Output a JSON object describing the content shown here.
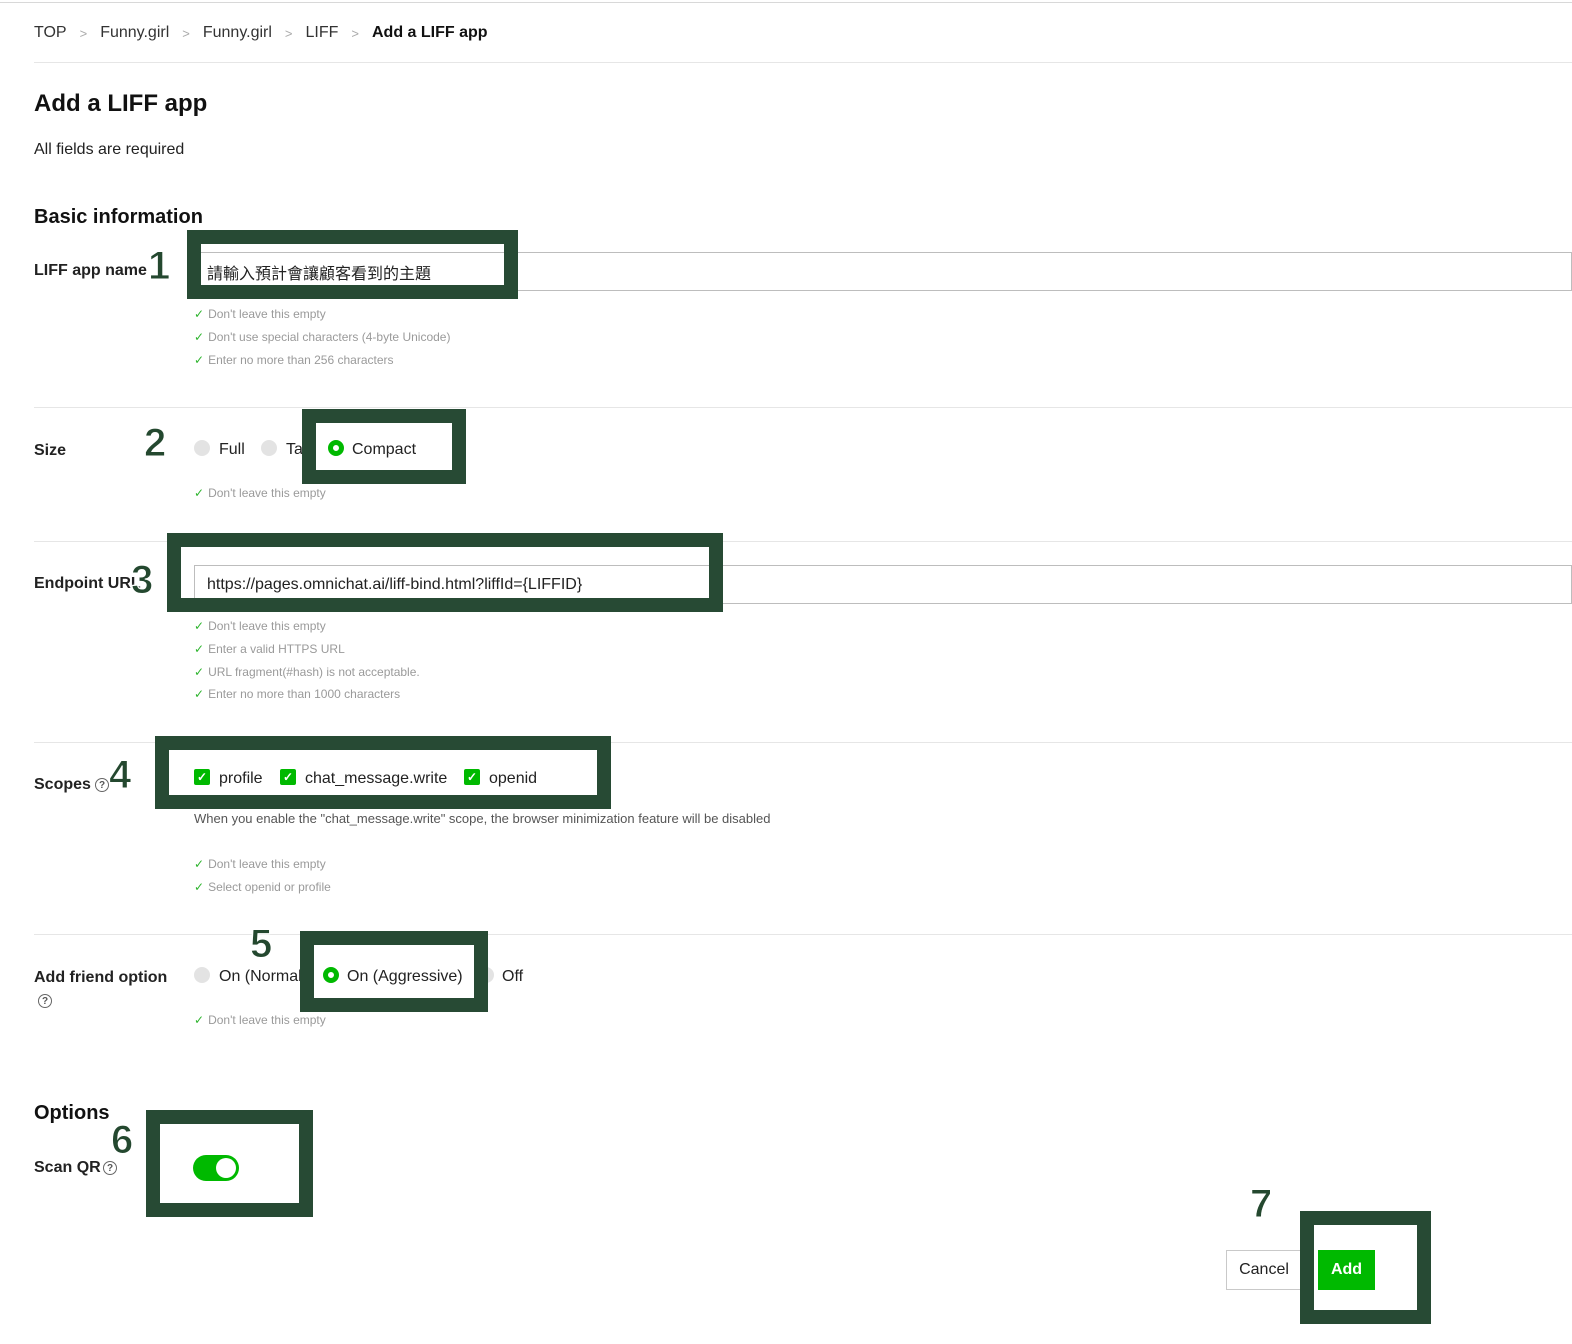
{
  "breadcrumb": [
    "TOP",
    "Funny.girl",
    "Funny.girl",
    "LIFF",
    "Add a LIFF app"
  ],
  "page_title": "Add a LIFF app",
  "required_note": "All fields are required",
  "basic_section_title": "Basic information",
  "app_name": {
    "label": "LIFF app name",
    "value": "請輸入預計會讓顧客看到的主題",
    "hints": [
      "Don't leave this empty",
      "Don't use special characters (4-byte Unicode)",
      "Enter no more than 256 characters"
    ]
  },
  "size": {
    "label": "Size",
    "options": [
      "Full",
      "Ta",
      "Compact"
    ],
    "selected": "Compact",
    "hints": [
      "Don't leave this empty"
    ]
  },
  "endpoint": {
    "label": "Endpoint URL",
    "value": "https://pages.omnichat.ai/liff-bind.html?liffId={LIFFID}",
    "hints": [
      "Don't leave this empty",
      "Enter a valid HTTPS URL",
      "URL fragment(#hash) is not acceptable.",
      "Enter no more than 1000 characters"
    ]
  },
  "scopes": {
    "label": "Scopes",
    "options": [
      "profile",
      "chat_message.write",
      "openid"
    ],
    "checked": [
      "profile",
      "chat_message.write",
      "openid"
    ],
    "note": "When you enable the \"chat_message.write\" scope, the browser minimization feature will be disabled",
    "hints": [
      "Don't leave this empty",
      "Select openid or profile"
    ]
  },
  "add_friend": {
    "label": "Add friend option",
    "options": [
      "On (Normal",
      "On (Aggressive)",
      "Off"
    ],
    "selected": "On (Aggressive)",
    "hints": [
      "Don't leave this empty"
    ]
  },
  "options_section_title": "Options",
  "scan_qr": {
    "label": "Scan QR",
    "enabled": true
  },
  "actions": {
    "cancel": "Cancel",
    "add": "Add"
  },
  "annotations": [
    "1",
    "2",
    "3",
    "4",
    "5",
    "6",
    "7"
  ],
  "colors": {
    "accent": "#00b900",
    "highlight_box": "#274a34",
    "check": "#2fb52f"
  },
  "icons": {
    "help": "question-circle-icon",
    "check": "checkmark-icon",
    "breadcrumb_separator": "chevron-right-icon"
  }
}
